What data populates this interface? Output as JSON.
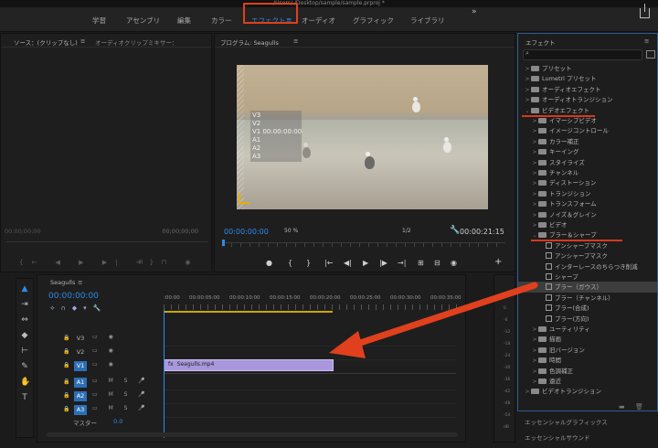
{
  "title_path": "/Users/          /Desktop/sample/sample.prproj *",
  "workspaces": [
    "学習",
    "アセンブリ",
    "編集",
    "カラー",
    "エフェクト",
    "オーディオ",
    "グラフィック",
    "ライブラリ"
  ],
  "workspace_active": "エフェクト",
  "workspace_active_menu": "≡",
  "workspace_more": "»",
  "source": {
    "tab_label": "ソース：(クリップなし)",
    "tab_menu": "≡",
    "tab2_label": "オーディオクリップミキサー：",
    "timecode_left": "00;00;00;00",
    "timecode_right": "00;00;00;00",
    "controls": "{← ◀ ▶ ▶| →}",
    "controls2": "⊓ ⊓ ◉"
  },
  "program": {
    "tab_label": "プログラム: Seagulls",
    "tab_menu": "≡",
    "timecode": "00:00:00:00",
    "zoom": "50 %",
    "resolution": "1/2",
    "duration": "00:00:21:15",
    "overlay": [
      "V3",
      "V2",
      "V1 00:00:00:00",
      "A1",
      "A2",
      "A3"
    ],
    "controls": [
      "●",
      "{",
      "}",
      "|←",
      "◀|",
      "▶",
      "|▶",
      "→|",
      "⊞",
      "⊟",
      "◉"
    ],
    "add": "+"
  },
  "effects": {
    "tab_label": "エフェクト",
    "tab_menu": "≡",
    "search_icon": "search-icon",
    "items": [
      {
        "label": "プリセット",
        "level": 0,
        "chev": ">",
        "kind": "folder"
      },
      {
        "label": "Lumetri プリセット",
        "level": 0,
        "chev": ">",
        "kind": "folder"
      },
      {
        "label": "オーディオエフェクト",
        "level": 0,
        "chev": ">",
        "kind": "folder"
      },
      {
        "label": "オーディオトランジション",
        "level": 0,
        "chev": ">",
        "kind": "folder"
      },
      {
        "label": "ビデオエフェクト",
        "level": 0,
        "chev": "⌄",
        "kind": "folder"
      },
      {
        "label": "イマーシブビデオ",
        "level": 1,
        "chev": ">",
        "kind": "folder"
      },
      {
        "label": "イメージコントロール",
        "level": 1,
        "chev": ">",
        "kind": "folder"
      },
      {
        "label": "カラー補正",
        "level": 1,
        "chev": ">",
        "kind": "folder"
      },
      {
        "label": "キーイング",
        "level": 1,
        "chev": ">",
        "kind": "folder"
      },
      {
        "label": "スタイライズ",
        "level": 1,
        "chev": ">",
        "kind": "folder"
      },
      {
        "label": "チャンネル",
        "level": 1,
        "chev": ">",
        "kind": "folder"
      },
      {
        "label": "ディストーション",
        "level": 1,
        "chev": ">",
        "kind": "folder"
      },
      {
        "label": "トランジション",
        "level": 1,
        "chev": ">",
        "kind": "folder"
      },
      {
        "label": "トランスフォーム",
        "level": 1,
        "chev": ">",
        "kind": "folder"
      },
      {
        "label": "ノイズ＆グレイン",
        "level": 1,
        "chev": ">",
        "kind": "folder"
      },
      {
        "label": "ビデオ",
        "level": 1,
        "chev": ">",
        "kind": "folder"
      },
      {
        "label": "ブラー＆シャープ",
        "level": 1,
        "chev": "⌄",
        "kind": "folder"
      },
      {
        "label": "アンシャープマスク",
        "level": 2,
        "chev": "",
        "kind": "preset"
      },
      {
        "label": "アンシャープマスク",
        "level": 2,
        "chev": "",
        "kind": "preset"
      },
      {
        "label": "インターレースのちらつき削減",
        "level": 2,
        "chev": "",
        "kind": "preset"
      },
      {
        "label": "シャープ",
        "level": 2,
        "chev": "",
        "kind": "preset"
      },
      {
        "label": "ブラー（ガウス）",
        "level": 2,
        "chev": "",
        "kind": "preset",
        "selected": true
      },
      {
        "label": "ブラー（チャンネル）",
        "level": 2,
        "chev": "",
        "kind": "preset"
      },
      {
        "label": "ブラー(合成)",
        "level": 2,
        "chev": "",
        "kind": "preset"
      },
      {
        "label": "ブラー(方向)",
        "level": 2,
        "chev": "",
        "kind": "preset"
      },
      {
        "label": "ユーティリティ",
        "level": 1,
        "chev": ">",
        "kind": "folder"
      },
      {
        "label": "描画",
        "level": 1,
        "chev": ">",
        "kind": "folder"
      },
      {
        "label": "旧バージョン",
        "level": 1,
        "chev": ">",
        "kind": "folder"
      },
      {
        "label": "時間",
        "level": 1,
        "chev": ">",
        "kind": "folder"
      },
      {
        "label": "色調補正",
        "level": 1,
        "chev": ">",
        "kind": "folder"
      },
      {
        "label": "遠近",
        "level": 1,
        "chev": ">",
        "kind": "folder"
      },
      {
        "label": "ビデオトランジション",
        "level": 0,
        "chev": ">",
        "kind": "folder"
      }
    ],
    "bottom": [
      "エッセンシャルグラフィックス",
      "エッセンシャルサウンド"
    ]
  },
  "timeline": {
    "tab_label": "Seagulls",
    "tab_menu": "≡",
    "timecode": "00:00:00:00",
    "ruler": [
      ":00:00",
      "00:00:05:00",
      "00:00:10:00",
      "00:00:15:00",
      "00:00:20:00",
      "00:00:25:00",
      "00:00:30:00",
      "00:00:35:00"
    ],
    "video_tracks": [
      "V3",
      "V2",
      "V1"
    ],
    "audio_tracks": [
      "A1",
      "A2",
      "A3"
    ],
    "audio_mid": "M S",
    "clip_label": "Seagulls.mp4",
    "clip_fx": "fx",
    "master_label": "マスター",
    "master_value": "0.0"
  },
  "meter_ticks": [
    "0",
    "-6",
    "-12",
    "-18",
    "-24",
    "-30",
    "-36",
    "-42",
    "-48",
    "-54",
    "dB"
  ],
  "colors": {
    "accent": "#2d8ceb",
    "annotation": "#e0401e",
    "clip": "#a897dd"
  }
}
